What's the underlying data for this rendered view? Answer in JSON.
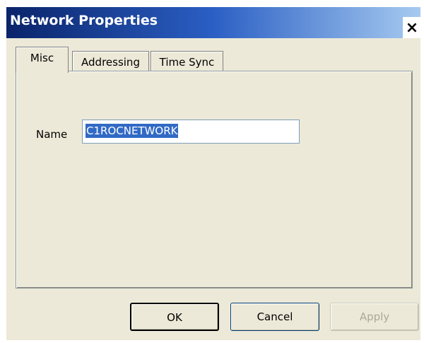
{
  "window": {
    "title": "Network Properties",
    "close_label": "×"
  },
  "tabs": [
    {
      "label": "Misc",
      "active": true
    },
    {
      "label": "Addressing",
      "active": false
    },
    {
      "label": "Time Sync",
      "active": false
    }
  ],
  "misc": {
    "name_label": "Name",
    "name_value": "C1ROCNETWORK"
  },
  "buttons": {
    "ok": "OK",
    "cancel": "Cancel",
    "apply": "Apply"
  },
  "colors": {
    "title_gradient_start": "#0a246a",
    "title_gradient_end": "#a6caf0",
    "dialog_bg": "#ece9d8",
    "selection": "#316ac5"
  }
}
